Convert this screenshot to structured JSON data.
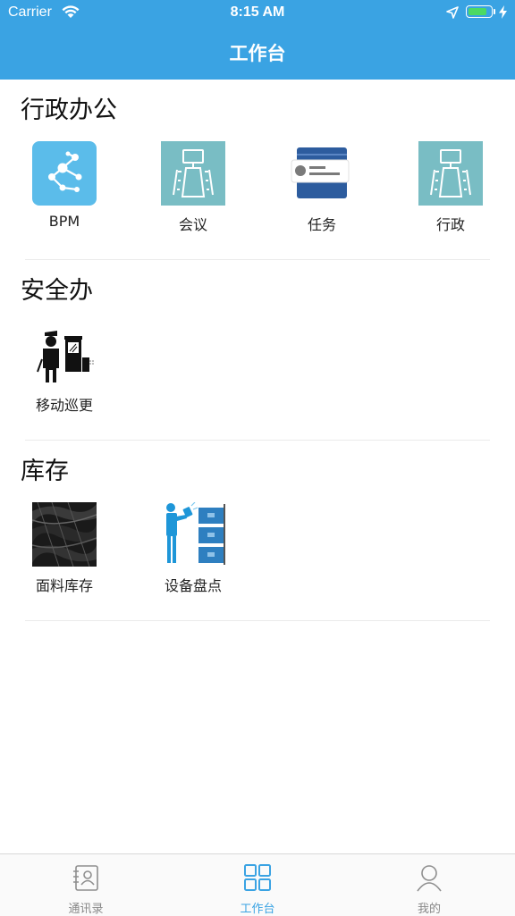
{
  "status_bar": {
    "carrier": "Carrier",
    "time": "8:15 AM",
    "battery_color": "#4cd964"
  },
  "header": {
    "title": "工作台",
    "background": "#3aa3e3"
  },
  "sections": [
    {
      "title": "行政办公",
      "items": [
        {
          "label": "BPM",
          "icon": "network-graph-icon"
        },
        {
          "label": "会议",
          "icon": "meeting-room-icon"
        },
        {
          "label": "任务",
          "icon": "task-card-icon"
        },
        {
          "label": "行政",
          "icon": "meeting-room-icon"
        }
      ]
    },
    {
      "title": "安全办",
      "items": [
        {
          "label": "移动巡更",
          "icon": "security-guard-icon"
        }
      ]
    },
    {
      "title": "库存",
      "items": [
        {
          "label": "面料库存",
          "icon": "fabric-photo-icon"
        },
        {
          "label": "设备盘点",
          "icon": "inventory-scan-icon"
        }
      ]
    }
  ],
  "tabbar": {
    "active_color": "#3aa3e3",
    "tabs": [
      {
        "label": "通讯录",
        "icon": "contacts-icon",
        "active": false
      },
      {
        "label": "工作台",
        "icon": "grid-icon",
        "active": true
      },
      {
        "label": "我的",
        "icon": "profile-icon",
        "active": false
      }
    ]
  }
}
